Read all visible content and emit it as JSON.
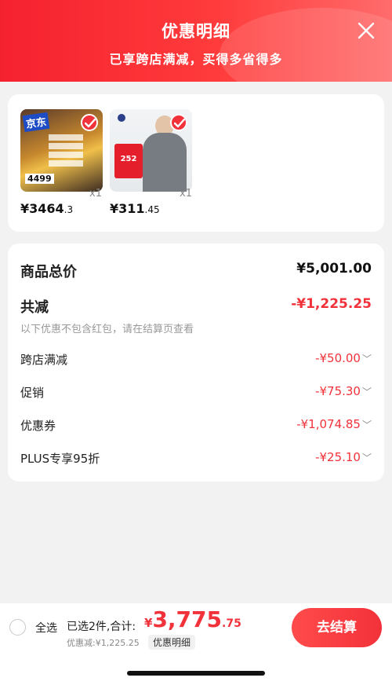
{
  "header": {
    "title": "优惠明细",
    "subtitle": "已享跨店满减，买得多省得多"
  },
  "products": [
    {
      "image_tags": [
        "京东",
        "4499"
      ],
      "price_int": "¥3464",
      "price_dec": ".3",
      "qty": "x1"
    },
    {
      "image_tags": [
        "252"
      ],
      "price_int": "¥311",
      "price_dec": ".45",
      "qty": "x1"
    }
  ],
  "summary": {
    "total_label": "商品总价",
    "total_value": "¥5,001.00",
    "reduce_label": "共减",
    "reduce_value": "-¥1,225.25",
    "note": "以下优惠不包含红包，请在结算页查看",
    "items": [
      {
        "label": "跨店满减",
        "value": "-¥50.00"
      },
      {
        "label": "促销",
        "value": "-¥75.30"
      },
      {
        "label": "优惠券",
        "value": "-¥1,074.85"
      },
      {
        "label": "PLUS专享95折",
        "value": "-¥25.10"
      }
    ]
  },
  "bottom": {
    "select_all": "全选",
    "selected_info": "已选2件,合计:",
    "total_symbol": "¥",
    "total_int": "3,775",
    "total_dec": ".75",
    "discount_line": "优惠减:¥1,225.25",
    "detail_link": "优惠明细",
    "checkout": "去结算"
  },
  "colors": {
    "accent": "#f2323a",
    "header_start": "#f5212f",
    "header_end": "#ff6b6b"
  },
  "icons": {
    "close": "close-icon",
    "check": "check-icon",
    "chevron": "chevron-down-icon"
  }
}
